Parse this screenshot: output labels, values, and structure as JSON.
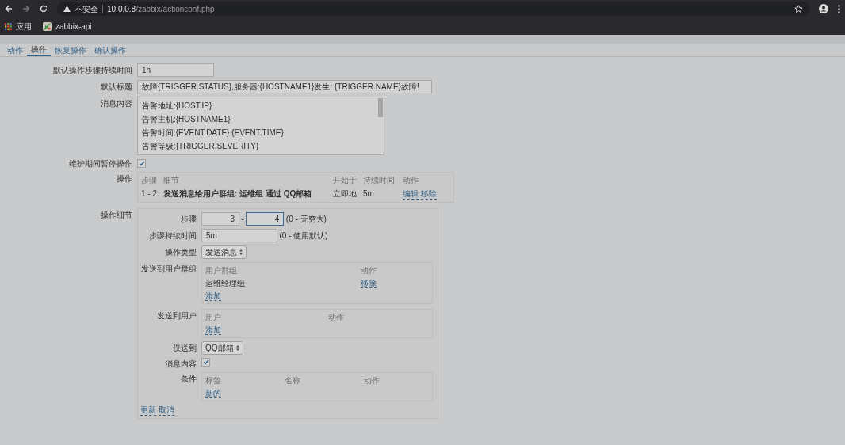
{
  "browser": {
    "security": "不安全",
    "url_host": "10.0.0.8",
    "url_path": "/zabbix/actionconf.php",
    "bookmarks": [
      {
        "label": "应用",
        "kind": "apps"
      },
      {
        "label": "zabbix-api",
        "kind": "site"
      }
    ]
  },
  "tabs": [
    {
      "label": "动作",
      "selected": false
    },
    {
      "label": "操作",
      "selected": true
    },
    {
      "label": "恢复操作",
      "selected": false
    },
    {
      "label": "确认操作",
      "selected": false
    }
  ],
  "form": {
    "default_step_duration": {
      "label": "默认操作步骤持续时间",
      "value": "1h"
    },
    "default_subject": {
      "label": "默认标题",
      "value": "故障{TRIGGER.STATUS},服务器:{HOSTNAME1}发生: {TRIGGER.NAME}故障!"
    },
    "default_message": {
      "label": "消息内容",
      "lines": [
        "告警地址:{HOST.IP}",
        "告警主机:{HOSTNAME1}",
        "告警时间:{EVENT.DATE} {EVENT.TIME}",
        "告警等级:{TRIGGER.SEVERITY}"
      ]
    },
    "pause_in_maintenance": {
      "label": "维护期间暂停操作",
      "checked": true
    },
    "operations": {
      "label": "操作",
      "columns": [
        "步骤",
        "细节",
        "开始于",
        "持续时间",
        "动作"
      ],
      "rows": [
        {
          "steps": "1 - 2",
          "details": "发送消息给用户群组: 运维组 通过 QQ邮箱",
          "start_in": "立即地",
          "duration": "5m",
          "actions": [
            "编辑",
            "移除"
          ]
        }
      ]
    },
    "operation_details": {
      "label": "操作细节",
      "steps": {
        "label": "步骤",
        "from": "3",
        "separator": "-",
        "to": "4",
        "hint": "(0 - 无穷大)"
      },
      "step_duration": {
        "label": "步骤持续时间",
        "value": "5m",
        "hint": "(0 - 使用默认)"
      },
      "operation_type": {
        "label": "操作类型",
        "value": "发送消息"
      },
      "user_groups": {
        "label": "发送到用户群组",
        "columns": [
          "用户群组",
          "动作"
        ],
        "rows": [
          {
            "name": "运维经理组",
            "action": "移除"
          }
        ],
        "add": "添加"
      },
      "users": {
        "label": "发送到用户",
        "columns": [
          "用户",
          "动作"
        ],
        "add": "添加"
      },
      "send_only_to": {
        "label": "仅送到",
        "value": "QQ邮箱"
      },
      "default_message": {
        "label": "消息内容",
        "checked": true
      },
      "conditions": {
        "label": "条件",
        "columns": [
          "标签",
          "名称",
          "动作"
        ],
        "add": "新的"
      },
      "buttons": [
        "更新",
        "取消"
      ]
    }
  }
}
